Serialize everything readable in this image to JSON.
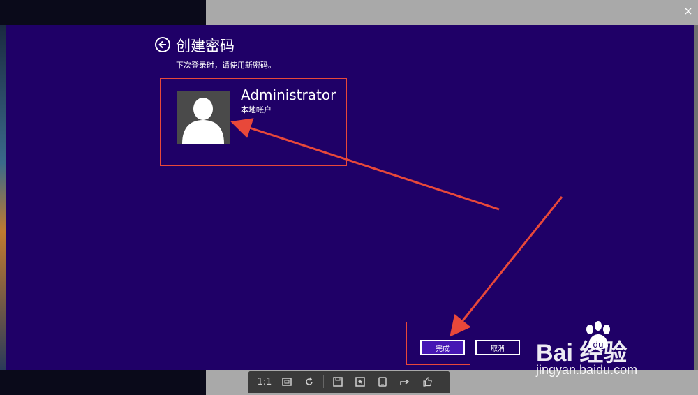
{
  "page": {
    "title": "创建密码",
    "subtitle": "下次登录时，请使用新密码。"
  },
  "account": {
    "name": "Administrator",
    "type": "本地帐户"
  },
  "buttons": {
    "finish": "完成",
    "cancel": "取消"
  },
  "window": {
    "close": "×"
  },
  "toolbar": {
    "zoom_actual": "1:1"
  },
  "watermark": {
    "brand": "Bai  经验",
    "url": "jingyan.baidu.com"
  },
  "colors": {
    "panel": "#1f0067",
    "accent_button": "#4617b4",
    "annotation_red": "#e8483a"
  }
}
